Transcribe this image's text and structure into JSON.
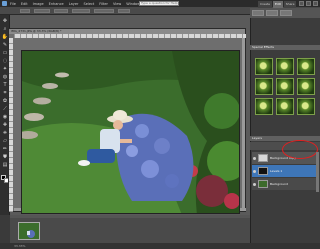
{
  "menu": {
    "items": [
      "File",
      "Edit",
      "Image",
      "Enhance",
      "Layer",
      "Select",
      "Filter",
      "View",
      "Window",
      "Help"
    ],
    "help_search": "Type a question for Help"
  },
  "tabs": [
    "Create",
    "Edit",
    "Share"
  ],
  "document": {
    "title": "IMG_4731.JPG @ 33.3% (RGB/8) *"
  },
  "panels": {
    "effects_title": "Special Effects",
    "layers_title": "Layers",
    "layers": [
      {
        "name": "Background copy"
      },
      {
        "name": "Levels 1"
      },
      {
        "name": "Background"
      }
    ]
  },
  "status": {
    "zoom": "33.33%"
  },
  "colors": {
    "accent": "#3e76b8",
    "highlight_ring": "#e02020"
  }
}
